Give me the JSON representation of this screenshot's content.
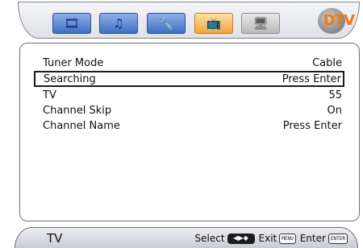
{
  "top_menu": {
    "tabs": [
      {
        "name": "picture",
        "icon": "film-strip-icon",
        "glyph": "🎞",
        "active": false
      },
      {
        "name": "audio",
        "icon": "music-note-icon",
        "glyph": "♫",
        "active": false
      },
      {
        "name": "setup",
        "icon": "wrench-icon",
        "glyph": "🔧",
        "active": false
      },
      {
        "name": "tv",
        "icon": "tv-icon",
        "glyph": "📺",
        "active": true
      },
      {
        "name": "pc",
        "icon": "monitor-icon",
        "glyph": "🖥",
        "active": false
      }
    ],
    "logo_text": "DTV",
    "colors": {
      "tab_blue": "#3f6fc4",
      "tab_active": "#f3a43b",
      "logo_orange": "#f07a10"
    }
  },
  "settings": {
    "rows": [
      {
        "label": "Tuner Mode",
        "value": "Cable"
      },
      {
        "label": "Searching",
        "value": "Press Enter"
      },
      {
        "label": "TV",
        "value": "55"
      },
      {
        "label": "Channel Skip",
        "value": "On"
      },
      {
        "label": "Channel Name",
        "value": "Press Enter"
      }
    ],
    "selected_index": 1
  },
  "footer": {
    "source": "TV",
    "select_label": "Select",
    "select_key_glyph": "◀▶◆",
    "exit_label": "Exit",
    "exit_key": "MENU",
    "enter_label": "Enter",
    "enter_key": "ENTER"
  }
}
